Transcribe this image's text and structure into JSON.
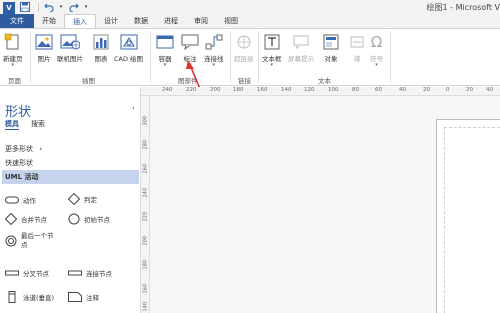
{
  "window": {
    "app_icon": "visio-icon",
    "title": "绘图1 - Microsoft V"
  },
  "quick_access": [
    "save-icon",
    "undo-icon",
    "redo-icon"
  ],
  "tabs": [
    {
      "label": "文件"
    },
    {
      "label": "开始"
    },
    {
      "label": "插入"
    },
    {
      "label": "设计"
    },
    {
      "label": "数据"
    },
    {
      "label": "进程"
    },
    {
      "label": "审阅"
    },
    {
      "label": "视图"
    }
  ],
  "ribbon": {
    "page": {
      "group": "页面",
      "new_page": "新建页"
    },
    "illustrations": {
      "group": "插图",
      "picture": "图片",
      "online_picture": "联机图片",
      "chart": "图表",
      "cad": "CAD 绘图"
    },
    "diagram_parts": {
      "group": "图部件",
      "container": "容器",
      "callout": "标注",
      "connector": "连接线"
    },
    "links": {
      "group": "链接",
      "hyperlink": "超链接"
    },
    "text": {
      "group": "文本",
      "textbox": "文本框",
      "screentip": "屏幕提示",
      "object": "对象",
      "field": "域",
      "symbol": "符号"
    },
    "accent_color": "#2f5c9f",
    "annotation_color": "#e0302a"
  },
  "shapes_panel": {
    "title": "形状",
    "tabs": [
      "模具",
      "搜索"
    ],
    "more_shapes": "更多形状",
    "quick_shapes": "快速形状",
    "active_stencil": "UML 活动",
    "shapes": [
      {
        "label": "动作",
        "icon": "action-icon"
      },
      {
        "label": "判定",
        "icon": "decision-icon"
      },
      {
        "label": "合并节点",
        "icon": "merge-node-icon"
      },
      {
        "label": "初始节点",
        "icon": "initial-node-icon"
      },
      {
        "label": "最后一个节点",
        "icon": "final-node-icon"
      },
      {
        "label": "分叉节点",
        "icon": "fork-node-icon"
      },
      {
        "label": "连接节点",
        "icon": "join-node-icon"
      },
      {
        "label": "泳道(垂直)",
        "icon": "swimlane-icon"
      },
      {
        "label": "注释",
        "icon": "comment-icon"
      }
    ]
  },
  "rulers": {
    "horizontal": [
      "240",
      "220",
      "200",
      "180",
      "160",
      "140",
      "120",
      "100",
      "80",
      "60",
      "40",
      "20",
      "0",
      "20",
      "40"
    ],
    "vertical": [
      "300",
      "280",
      "260",
      "240",
      "220",
      "200",
      "180",
      "160",
      "140"
    ]
  }
}
